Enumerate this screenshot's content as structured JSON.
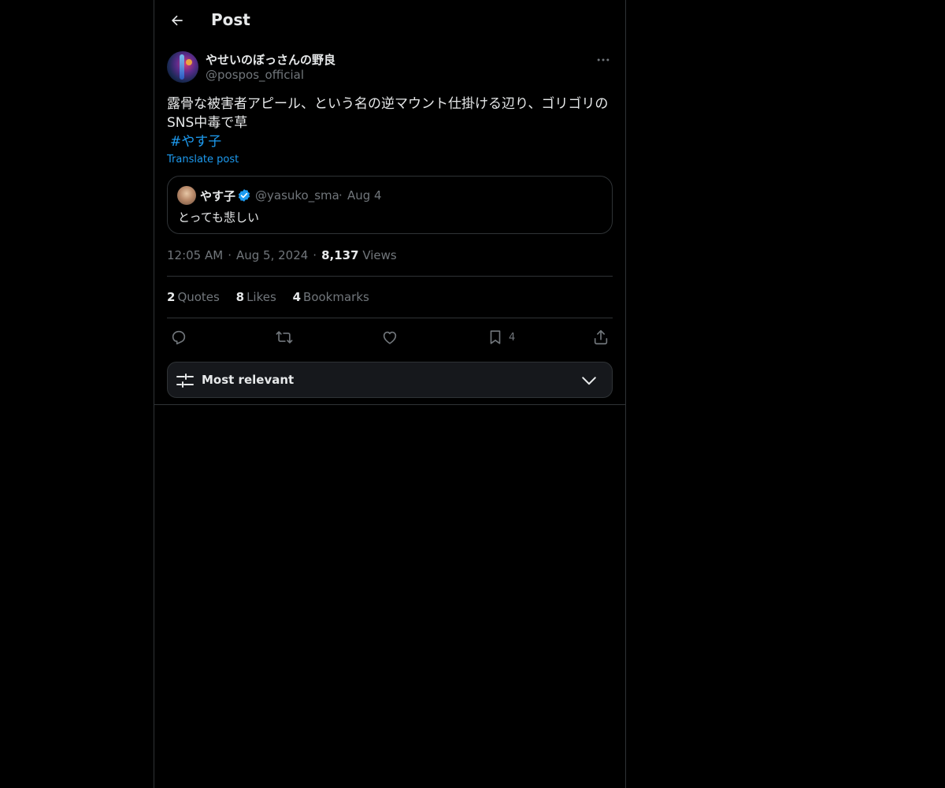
{
  "header": {
    "title": "Post",
    "back_icon": "arrow-left-icon"
  },
  "post": {
    "author": {
      "display_name": "やせいのぼっさんの野良",
      "handle": "@pospos_official"
    },
    "text_lines": [
      "露骨な被害者アピール、という名の逆マウント仕掛ける辺り、ゴリゴリの",
      "SNS中毒で草"
    ],
    "hashtag": "#やす子",
    "translate_label": "Translate post",
    "quote": {
      "name": "やす子",
      "handle": "@yasuko_sma",
      "separator": "·",
      "date": "Aug 4",
      "text": "とっても悲しい"
    },
    "meta": {
      "time": "12:05 AM",
      "separator": "·",
      "date": "Aug 5, 2024",
      "views_count": "8,137",
      "views_label": "Views"
    },
    "stats": {
      "quotes_count": "2",
      "quotes_label": "Quotes",
      "likes_count": "8",
      "likes_label": "Likes",
      "bookmarks_count": "4",
      "bookmarks_label": "Bookmarks"
    },
    "actions": {
      "bookmark_count": "4",
      "icons": [
        "reply-icon",
        "repost-icon",
        "like-icon",
        "bookmark-icon",
        "share-icon"
      ]
    }
  },
  "sort": {
    "label": "Most relevant"
  },
  "colors": {
    "background": "#000000",
    "text": "#e7e9ea",
    "muted": "#71767b",
    "accent": "#1d9bf0",
    "border": "#2f3336"
  }
}
